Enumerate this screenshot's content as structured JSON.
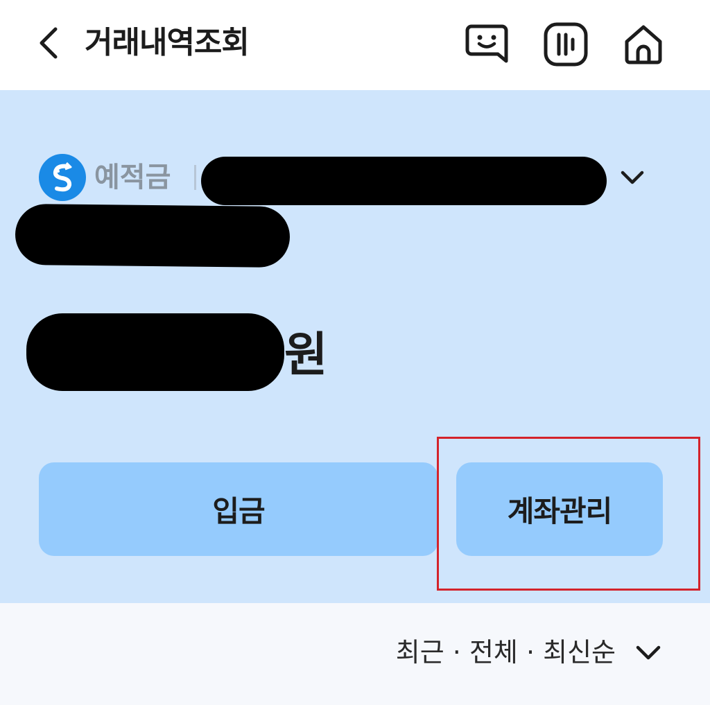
{
  "header": {
    "title": "거래내역조회",
    "icons": [
      "chevron-left-icon",
      "chat-icon",
      "menu-icon",
      "home-icon"
    ]
  },
  "account": {
    "type": "예적금",
    "currency": "원",
    "logo": "bank-logo-icon"
  },
  "actions": {
    "deposit_label": "입금",
    "manage_label": "계좌관리"
  },
  "filter": {
    "label": "최근 · 전체 · 최신순"
  },
  "colors": {
    "card_bg": "#cfe5fc",
    "button_bg": "#95cbfd",
    "logo_blue": "#1a8ae6",
    "highlight_red": "#d4232b",
    "filter_bg": "#f6f8fc"
  }
}
